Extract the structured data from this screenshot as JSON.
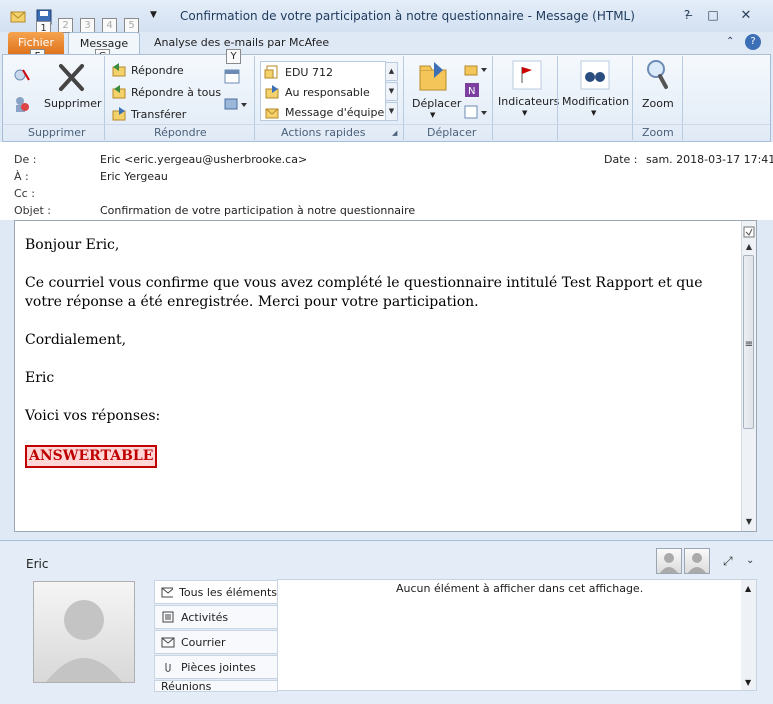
{
  "window": {
    "title": "Confirmation de votre participation à notre questionnaire  -  Message (HTML)",
    "qat_keys": [
      "1",
      "2",
      "3",
      "4",
      "5"
    ]
  },
  "ribbon": {
    "tabs": {
      "file": "Fichier",
      "message": "Message",
      "mcafee": "Analyse des e-mails par McAfee"
    },
    "keytips": {
      "file": "F",
      "message": "G",
      "y": "Y"
    },
    "delete": {
      "label": "Supprimer",
      "group": "Supprimer"
    },
    "respond": {
      "reply": "Répondre",
      "reply_all": "Répondre à tous",
      "forward": "Transférer",
      "group": "Répondre"
    },
    "quick_steps": {
      "items": [
        "EDU 712",
        "Au responsable",
        "Message d'équipe"
      ],
      "group": "Actions rapides"
    },
    "move": {
      "label": "Déplacer",
      "group": "Déplacer"
    },
    "tags": {
      "flags": "Indicateurs",
      "edit": "Modification"
    },
    "zoom": {
      "label": "Zoom",
      "group": "Zoom"
    }
  },
  "header": {
    "from_label": "De :",
    "from_value": "Eric <eric.yergeau@usherbrooke.ca>",
    "to_label": "À :",
    "to_value": "Eric Yergeau",
    "cc_label": "Cc :",
    "subject_label": "Objet :",
    "subject_value": "Confirmation de votre participation à notre questionnaire",
    "date_label": "Date :",
    "date_value": "sam. 2018-03-17 17:41"
  },
  "body": {
    "greeting": "Bonjour Eric,",
    "paragraph": "Ce courriel vous confirme que vous avez complété le questionnaire intitulé Test Rapport et que votre réponse a été enregistrée. Merci pour votre participation.",
    "closing": "Cordialement,",
    "signature": "Eric",
    "answers_intro": "Voici vos réponses:",
    "answer": "ANSWERTABLE"
  },
  "people_pane": {
    "name": "Eric",
    "tabs": [
      "Tous les éléments",
      "Activités",
      "Courrier",
      "Pièces jointes",
      "Réunions"
    ],
    "empty_message": "Aucun élément à afficher dans cet affichage."
  }
}
